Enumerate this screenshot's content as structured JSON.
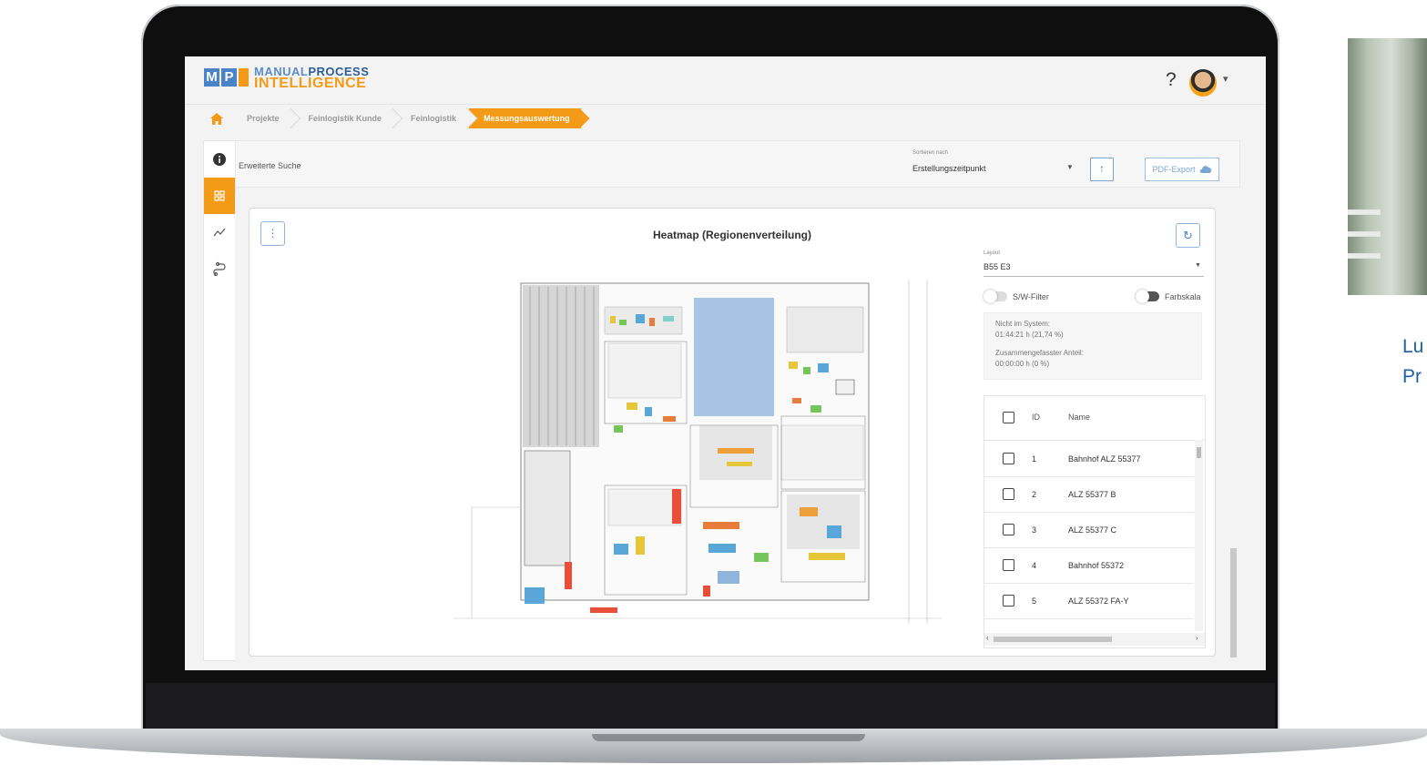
{
  "app": {
    "logo_letters": [
      "M",
      "P",
      "I"
    ],
    "logo_line1_a": "MANUAL",
    "logo_line1_b": "PROCESS",
    "logo_line2": "INTELLIGENCE",
    "help_label": "?",
    "brand_orange": "#f39a16",
    "brand_blue": "#4a83c8"
  },
  "breadcrumb": {
    "home_icon": "home-icon",
    "items": [
      "Projekte",
      "Feinlogistik Kunde",
      "Feinlogistik",
      "Messungsauswertung"
    ]
  },
  "rail": {
    "icons": [
      "info-icon",
      "dashboard-grid-icon",
      "analytics-icon",
      "route-icon"
    ]
  },
  "search": {
    "placeholder": "Erweiterte Suche",
    "sort_label": "Sortieren nach",
    "sort_value": "Erstellungszeitpunkt",
    "sort_direction_icon": "arrow-up-icon",
    "pdf_export_label": "PDF-Export"
  },
  "card": {
    "title": "Heatmap (Regionenverteilung)",
    "layout_label": "Layout",
    "layout_value": "B55 E3",
    "toggle_sw": "S/W-Filter",
    "toggle_color": "Farbskala",
    "not_in_system_label": "Nicht im System:",
    "not_in_system_value": "01:44:21 h (21,74 %)",
    "combined_label": "Zusammengefasster Anteil:",
    "combined_value": "00:00:00 h (0 %)"
  },
  "table": {
    "headers": {
      "id": "ID",
      "name": "Name"
    },
    "rows": [
      {
        "id": "1",
        "name": "Bahnhof ALZ 55377"
      },
      {
        "id": "2",
        "name": "ALZ 55377 B"
      },
      {
        "id": "3",
        "name": "ALZ 55377 C"
      },
      {
        "id": "4",
        "name": "Bahnhof 55372"
      },
      {
        "id": "5",
        "name": "ALZ 55372 FA-Y"
      }
    ]
  },
  "side": {
    "caption_line1": "Lu",
    "caption_line2": "Pr"
  }
}
